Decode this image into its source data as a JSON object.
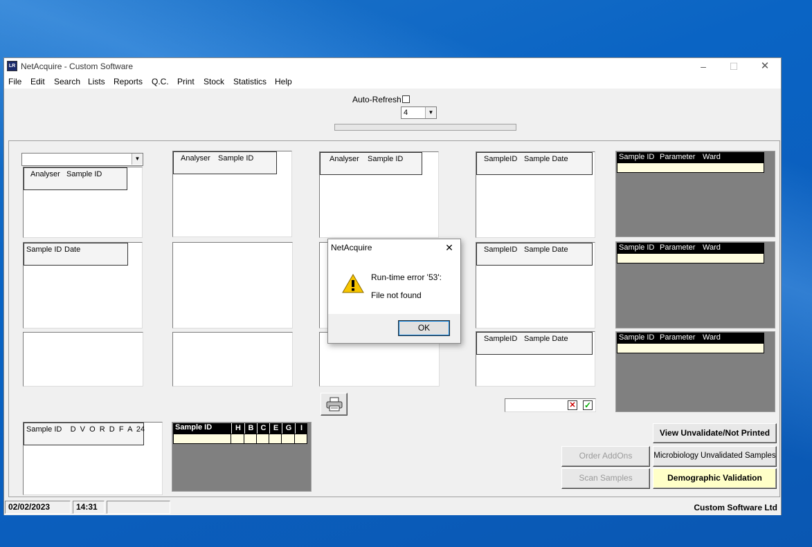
{
  "window": {
    "title": "NetAcquire - Custom Software",
    "icon_label": "LR",
    "controls": {
      "minimize": "–",
      "maximize": "☐",
      "close": "✕"
    }
  },
  "menu": [
    "File",
    "Edit",
    "Search",
    "Lists",
    "Reports",
    "Q.C.",
    "Print",
    "Stock",
    "Statistics",
    "Help"
  ],
  "toolbar": {
    "auto_refresh_label": "Auto-Refresh",
    "auto_refresh_checked": false,
    "refresh_interval": "4"
  },
  "grids": {
    "analyser_header": {
      "col1": "Analyser",
      "col2": "Sample ID"
    },
    "sample_date_header": {
      "col1": "Sample ID",
      "col2": "Date"
    },
    "sampleid_date_header": {
      "col1": "SampleID",
      "col2": "Sample Date"
    },
    "param_header": {
      "col1": "Sample ID",
      "col2": "Parameter",
      "col3": "Ward"
    },
    "dvordfa_header": "Sample ID    D  V  O  R  D  F  A  24",
    "hb_header": {
      "sample_id": "Sample ID",
      "cols": [
        "H",
        "B",
        "C",
        "E",
        "G",
        "I"
      ]
    }
  },
  "filter_combo_value": "",
  "buttons": {
    "view_unvalidate": "View Unvalidate/Not Printed",
    "order_addons": "Order AddOns",
    "micro_unvalidated": "Microbiology Unvalidated Samples",
    "scan_samples": "Scan Samples",
    "demographic_validation": "Demographic Validation"
  },
  "status": {
    "date": "02/02/2023",
    "time": "14:31",
    "company": "Custom Software Ltd"
  },
  "dialog": {
    "title": "NetAcquire",
    "error_line": "Run-time error '53':",
    "message": "File not found",
    "ok_label": "OK",
    "icon": "warning-icon"
  }
}
